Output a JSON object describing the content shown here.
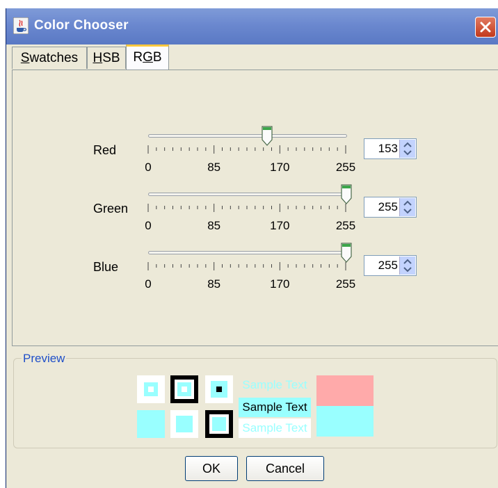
{
  "window": {
    "title": "Color Chooser"
  },
  "tabs": [
    {
      "label": "Swatches",
      "mnemonic": "S",
      "rest": "watches"
    },
    {
      "label": "HSB",
      "mnemonic": "H",
      "rest": "SB"
    },
    {
      "label": "RGB",
      "pre": "R",
      "mnemonic": "G",
      "rest": "B",
      "active": true
    }
  ],
  "sliders": [
    {
      "label": "Red",
      "value": 153,
      "value_text": "153",
      "min": 0,
      "max": 255
    },
    {
      "label": "Green",
      "value": 255,
      "value_text": "255",
      "min": 0,
      "max": 255
    },
    {
      "label": "Blue",
      "value": 255,
      "value_text": "255",
      "min": 0,
      "max": 255
    }
  ],
  "tick_labels": [
    "0",
    "85",
    "170",
    "255"
  ],
  "preview": {
    "title": "Preview",
    "sample_text": "Sample Text",
    "selected_color": "#99ffff",
    "old_color": "#ffaaaa"
  },
  "buttons": {
    "ok": "OK",
    "cancel": "Cancel"
  },
  "icons": {
    "app": "java-cup-icon",
    "close": "close-icon",
    "thumb": "slider-thumb-icon",
    "spinner": "spinner-arrows-icon"
  }
}
